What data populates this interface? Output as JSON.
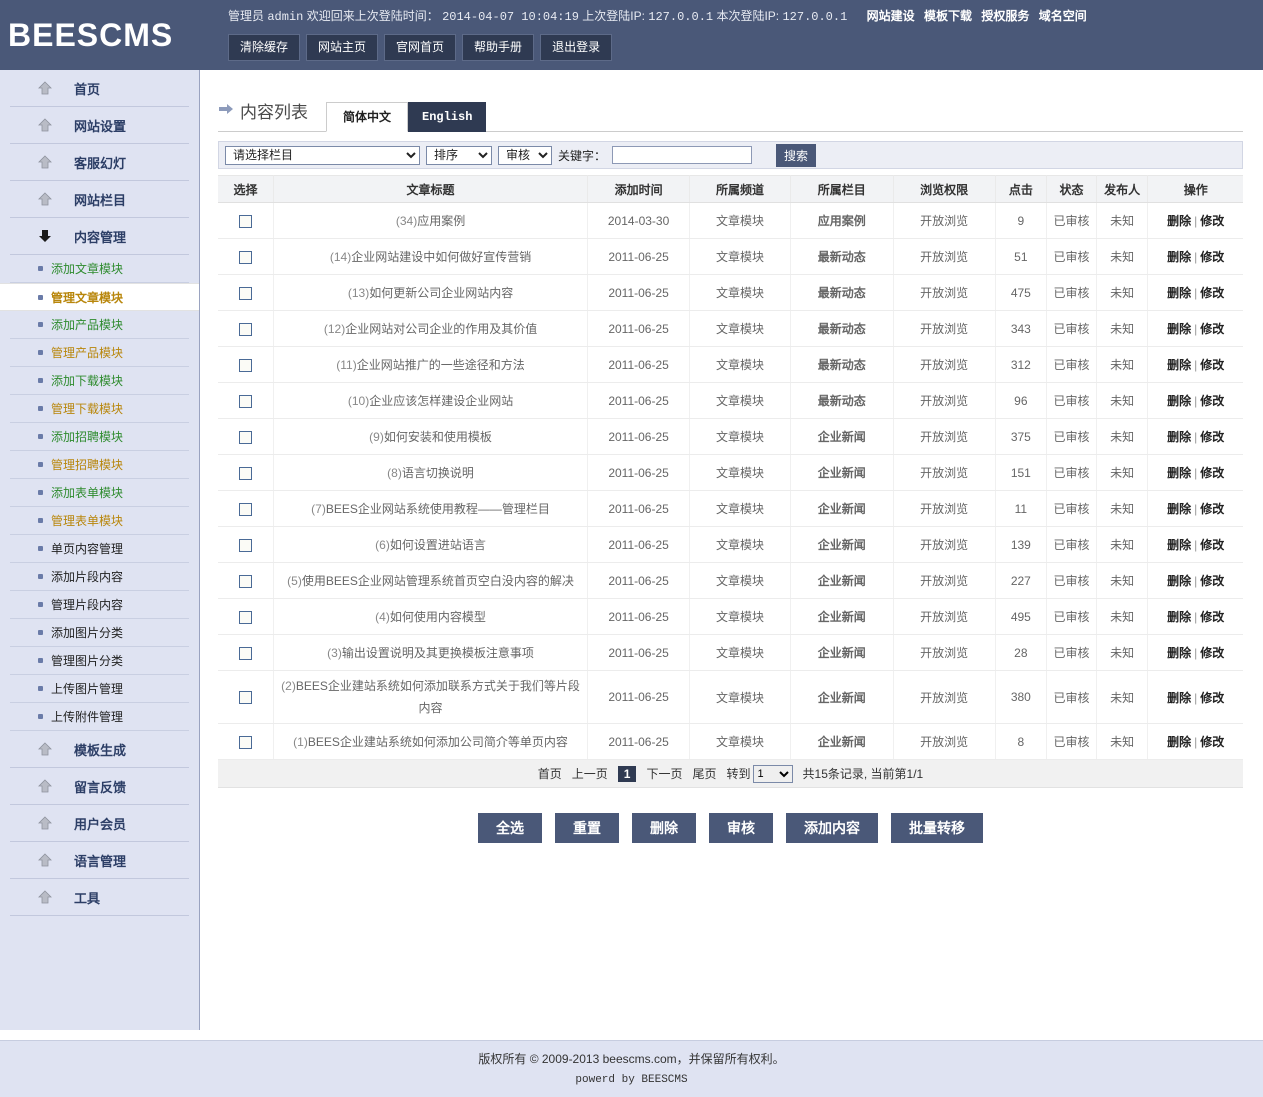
{
  "brand": {
    "logo": "BEESCMS"
  },
  "topbar": {
    "info_prefix": "管理员",
    "admin_name": "admin",
    "welcome": "欢迎回来上次登陆时间：",
    "last_login_time": "2014-04-07 10:04:19",
    "last_ip_label": "上次登陆IP:",
    "last_ip": "127.0.0.1",
    "cur_ip_label": "本次登陆IP:",
    "cur_ip": "127.0.0.1",
    "links": [
      "网站建设",
      "模板下载",
      "授权服务",
      "域名空间"
    ],
    "menu": [
      "清除缓存",
      "网站主页",
      "官网首页",
      "帮助手册",
      "退出登录"
    ]
  },
  "sidebar": {
    "groups": [
      {
        "label": "首页",
        "icon": "arrow-up-icon",
        "expanded": false
      },
      {
        "label": "网站设置",
        "icon": "arrow-up-icon",
        "expanded": false
      },
      {
        "label": "客服幻灯",
        "icon": "arrow-up-icon",
        "expanded": false
      },
      {
        "label": "网站栏目",
        "icon": "arrow-up-icon",
        "expanded": false
      },
      {
        "label": "内容管理",
        "icon": "arrow-down-icon",
        "expanded": true
      }
    ],
    "sub_items": [
      {
        "label": "添加文章模块",
        "style": "green",
        "active": false
      },
      {
        "label": "管理文章模块",
        "style": "gold",
        "active": true
      },
      {
        "label": "添加产品模块",
        "style": "green",
        "active": false
      },
      {
        "label": "管理产品模块",
        "style": "gold",
        "active": false
      },
      {
        "label": "添加下载模块",
        "style": "green",
        "active": false
      },
      {
        "label": "管理下载模块",
        "style": "gold",
        "active": false
      },
      {
        "label": "添加招聘模块",
        "style": "green",
        "active": false
      },
      {
        "label": "管理招聘模块",
        "style": "gold",
        "active": false
      },
      {
        "label": "添加表单模块",
        "style": "green",
        "active": false
      },
      {
        "label": "管理表单模块",
        "style": "gold",
        "active": false
      },
      {
        "label": "单页内容管理",
        "style": "dark",
        "active": false
      },
      {
        "label": "添加片段内容",
        "style": "dark",
        "active": false
      },
      {
        "label": "管理片段内容",
        "style": "dark",
        "active": false
      },
      {
        "label": "添加图片分类",
        "style": "dark",
        "active": false
      },
      {
        "label": "管理图片分类",
        "style": "dark",
        "active": false
      },
      {
        "label": "上传图片管理",
        "style": "dark",
        "active": false
      },
      {
        "label": "上传附件管理",
        "style": "dark",
        "active": false
      }
    ],
    "groups_after": [
      {
        "label": "模板生成",
        "icon": "arrow-up-icon"
      },
      {
        "label": "留言反馈",
        "icon": "arrow-up-icon"
      },
      {
        "label": "用户会员",
        "icon": "arrow-up-icon"
      },
      {
        "label": "语言管理",
        "icon": "arrow-up-icon"
      },
      {
        "label": "工具",
        "icon": "arrow-up-icon"
      }
    ]
  },
  "page": {
    "title": "内容列表",
    "tabs": [
      {
        "label": "简体中文",
        "active": true
      },
      {
        "label": "English",
        "active": false
      }
    ]
  },
  "filters": {
    "column_select": "请选择栏目",
    "sort_select": "排序",
    "audit_select": "审核",
    "keyword_label": "关键字：",
    "keyword_value": "",
    "keyword_placeholder": "",
    "search_button": "搜索"
  },
  "table": {
    "headers": [
      "选择",
      "文章标题",
      "添加时间",
      "所属频道",
      "所属栏目",
      "浏览权限",
      "点击",
      "状态",
      "发布人",
      "操作"
    ],
    "action_delete": "删除",
    "action_edit": "修改",
    "action_sep": "|",
    "rows": [
      {
        "idx": "(34)",
        "title": "应用案例",
        "date": "2014-03-30",
        "channel": "文章模块",
        "column": "应用案例",
        "perm": "开放浏览",
        "hits": "9",
        "status": "已审核",
        "author": "未知"
      },
      {
        "idx": "(14)",
        "title": "企业网站建设中如何做好宣传营销",
        "date": "2011-06-25",
        "channel": "文章模块",
        "column": "最新动态",
        "perm": "开放浏览",
        "hits": "51",
        "status": "已审核",
        "author": "未知"
      },
      {
        "idx": "(13)",
        "title": "如何更新公司企业网站内容",
        "date": "2011-06-25",
        "channel": "文章模块",
        "column": "最新动态",
        "perm": "开放浏览",
        "hits": "475",
        "status": "已审核",
        "author": "未知"
      },
      {
        "idx": "(12)",
        "title": "企业网站对公司企业的作用及其价值",
        "date": "2011-06-25",
        "channel": "文章模块",
        "column": "最新动态",
        "perm": "开放浏览",
        "hits": "343",
        "status": "已审核",
        "author": "未知"
      },
      {
        "idx": "(11)",
        "title": "企业网站推广的一些途径和方法",
        "date": "2011-06-25",
        "channel": "文章模块",
        "column": "最新动态",
        "perm": "开放浏览",
        "hits": "312",
        "status": "已审核",
        "author": "未知"
      },
      {
        "idx": "(10)",
        "title": "企业应该怎样建设企业网站",
        "date": "2011-06-25",
        "channel": "文章模块",
        "column": "最新动态",
        "perm": "开放浏览",
        "hits": "96",
        "status": "已审核",
        "author": "未知"
      },
      {
        "idx": "(9)",
        "title": "如何安装和使用模板",
        "date": "2011-06-25",
        "channel": "文章模块",
        "column": "企业新闻",
        "perm": "开放浏览",
        "hits": "375",
        "status": "已审核",
        "author": "未知"
      },
      {
        "idx": "(8)",
        "title": "语言切换说明",
        "date": "2011-06-25",
        "channel": "文章模块",
        "column": "企业新闻",
        "perm": "开放浏览",
        "hits": "151",
        "status": "已审核",
        "author": "未知"
      },
      {
        "idx": "(7)",
        "title": "BEES企业网站系统使用教程——管理栏目",
        "date": "2011-06-25",
        "channel": "文章模块",
        "column": "企业新闻",
        "perm": "开放浏览",
        "hits": "11",
        "status": "已审核",
        "author": "未知"
      },
      {
        "idx": "(6)",
        "title": "如何设置进站语言",
        "date": "2011-06-25",
        "channel": "文章模块",
        "column": "企业新闻",
        "perm": "开放浏览",
        "hits": "139",
        "status": "已审核",
        "author": "未知"
      },
      {
        "idx": "(5)",
        "title": "使用BEES企业网站管理系统首页空白没内容的解决",
        "date": "2011-06-25",
        "channel": "文章模块",
        "column": "企业新闻",
        "perm": "开放浏览",
        "hits": "227",
        "status": "已审核",
        "author": "未知"
      },
      {
        "idx": "(4)",
        "title": "如何使用内容模型",
        "date": "2011-06-25",
        "channel": "文章模块",
        "column": "企业新闻",
        "perm": "开放浏览",
        "hits": "495",
        "status": "已审核",
        "author": "未知"
      },
      {
        "idx": "(3)",
        "title": "输出设置说明及其更换模板注意事项",
        "date": "2011-06-25",
        "channel": "文章模块",
        "column": "企业新闻",
        "perm": "开放浏览",
        "hits": "28",
        "status": "已审核",
        "author": "未知"
      },
      {
        "idx": "(2)",
        "title": "BEES企业建站系统如何添加联系方式关于我们等片段内容",
        "date": "2011-06-25",
        "channel": "文章模块",
        "column": "企业新闻",
        "perm": "开放浏览",
        "hits": "380",
        "status": "已审核",
        "author": "未知"
      },
      {
        "idx": "(1)",
        "title": "BEES企业建站系统如何添加公司简介等单页内容",
        "date": "2011-06-25",
        "channel": "文章模块",
        "column": "企业新闻",
        "perm": "开放浏览",
        "hits": "8",
        "status": "已审核",
        "author": "未知"
      }
    ]
  },
  "pager": {
    "first": "首页",
    "prev": "上一页",
    "current": "1",
    "next": "下一页",
    "last": "尾页",
    "goto_label": "转到",
    "goto_value": "1",
    "summary": "共15条记录, 当前第1/1"
  },
  "actions": [
    "全选",
    "重置",
    "删除",
    "审核",
    "添加内容",
    "批量转移"
  ],
  "footer": {
    "copyright": "版权所有 © 2009-2013 beescms.com，并保留所有权利。",
    "powered": "powerd by BEESCMS"
  },
  "colors": {
    "header_bg": "#4a5878",
    "sidebar_bg": "#dfe3f2",
    "tab_active_bg": "#ffffff",
    "tab_inactive_bg": "#2f3a52",
    "accent_green": "#2e8b2e",
    "accent_gold": "#b8860b",
    "button_bg": "#4a5878"
  }
}
